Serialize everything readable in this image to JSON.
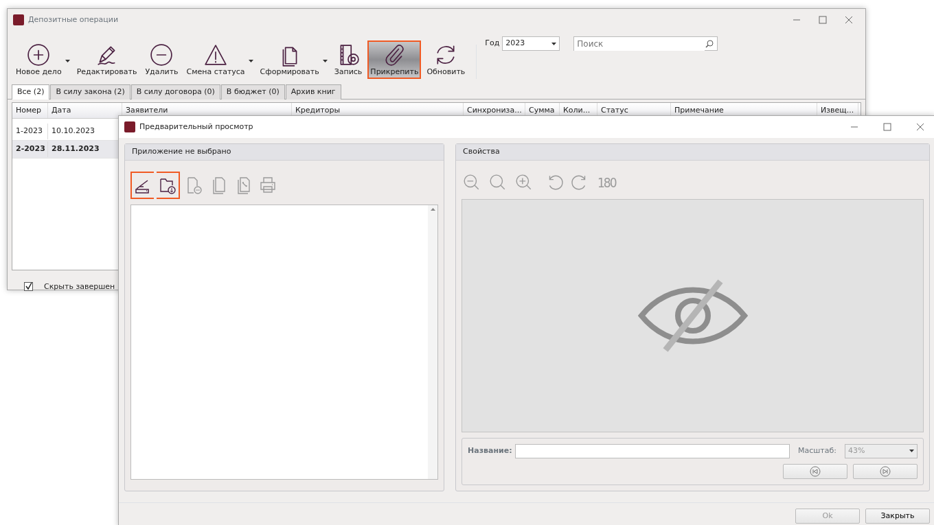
{
  "main_window": {
    "title": "Депозитные операции",
    "toolbar": [
      {
        "label": "Новое дело",
        "dropdown": true,
        "pressed": false,
        "highlighted": false
      },
      {
        "label": "Редактировать",
        "dropdown": false,
        "pressed": false,
        "highlighted": false
      },
      {
        "label": "Удалить",
        "dropdown": false,
        "pressed": false,
        "highlighted": false
      },
      {
        "label": "Смена статуса",
        "dropdown": true,
        "pressed": false,
        "highlighted": false
      },
      {
        "label": "Сформировать",
        "dropdown": true,
        "pressed": false,
        "highlighted": false
      },
      {
        "label": "Запись",
        "dropdown": false,
        "pressed": false,
        "highlighted": false
      },
      {
        "label": "Прикрепить",
        "dropdown": false,
        "pressed": true,
        "highlighted": true
      },
      {
        "label": "Обновить",
        "dropdown": false,
        "pressed": false,
        "highlighted": false
      }
    ],
    "year": {
      "label": "Год",
      "value": "2023"
    },
    "search": {
      "placeholder": "Поиск"
    },
    "tabs": [
      {
        "label": "Все (2)",
        "selected": true
      },
      {
        "label": "В силу закона (2)",
        "selected": false
      },
      {
        "label": "В силу договора (0)",
        "selected": false
      },
      {
        "label": "В бюджет (0)",
        "selected": false
      },
      {
        "label": "Архив книг",
        "selected": false
      }
    ],
    "table": {
      "columns": [
        "Номер",
        "Дата",
        "Заявители",
        "Кредиторы",
        "Синхрониза...",
        "Сумма",
        "Коли...",
        "Статус",
        "Примечание",
        "Извещ..."
      ],
      "rows": [
        {
          "cells": [
            "1-2023",
            "10.10.2023"
          ],
          "selected": false
        },
        {
          "cells": [
            "2-2023",
            "28.11.2023"
          ],
          "selected": true
        }
      ]
    },
    "hide_completed": {
      "label": "Скрыть завершен",
      "checked": true
    }
  },
  "dialog": {
    "title": "Предварительный просмотр",
    "attachment_panel": {
      "title": "Приложение не выбрано",
      "tools": [
        {
          "disabled": false,
          "highlighted": true
        },
        {
          "disabled": false,
          "highlighted": true
        },
        {
          "disabled": true,
          "highlighted": false
        },
        {
          "disabled": true,
          "highlighted": false
        },
        {
          "disabled": true,
          "highlighted": false
        },
        {
          "disabled": true,
          "highlighted": false
        }
      ]
    },
    "properties_panel": {
      "title": "Свойства",
      "tools": [
        {
          "disabled": true
        },
        {
          "disabled": true
        },
        {
          "disabled": true
        },
        {
          "disabled": true
        },
        {
          "disabled": true
        },
        {
          "text": "180",
          "disabled": true
        }
      ],
      "name_label": "Название:",
      "scale_label": "Масштаб:",
      "scale_value": "43%"
    },
    "buttons": [
      {
        "label": "Ok",
        "disabled": true
      },
      {
        "label": "Закрыть",
        "disabled": false
      }
    ]
  }
}
